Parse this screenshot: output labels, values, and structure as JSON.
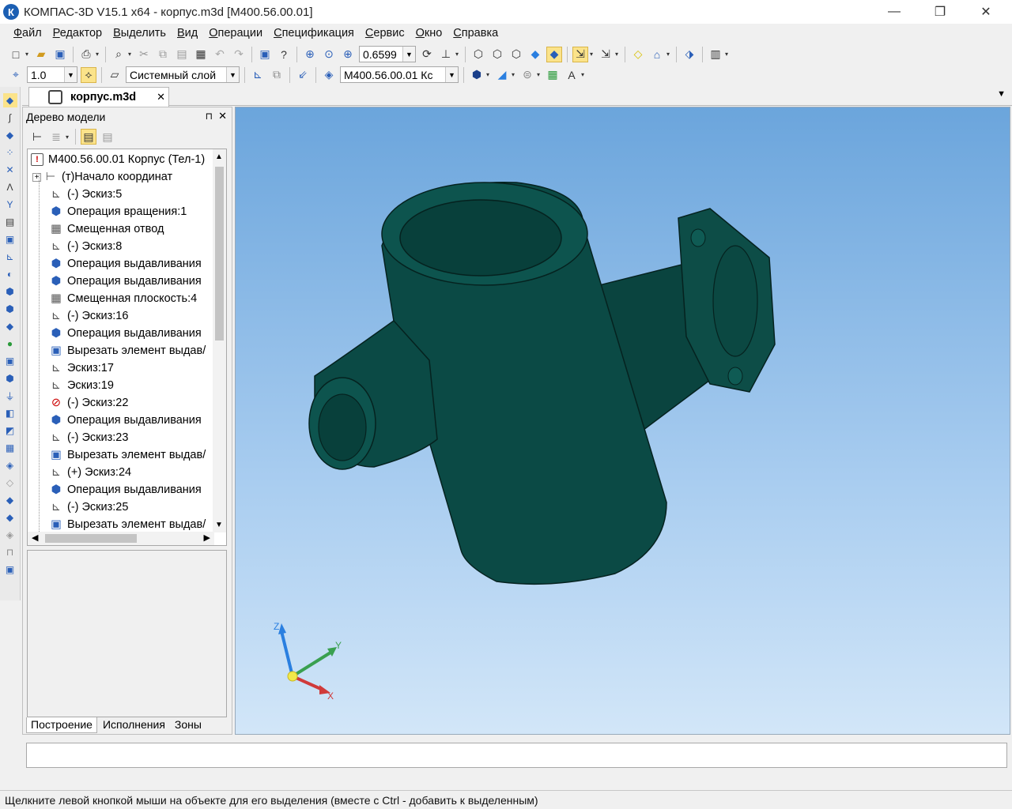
{
  "window": {
    "app_icon": "К",
    "title": "КОМПАС-3D V15.1 x64 - корпус.m3d [M400.56.00.01]",
    "minimize": "—",
    "maximize": "❐",
    "close": "✕"
  },
  "menu": [
    "Файл",
    "Редактор",
    "Выделить",
    "Вид",
    "Операции",
    "Спецификация",
    "Сервис",
    "Окно",
    "Справка"
  ],
  "toolbar1": {
    "zoom_value": "0.6599"
  },
  "toolbar2": {
    "step_value": "1.0",
    "layer": "Системный слой",
    "designation": "М400.56.00.01 Кс"
  },
  "document_tab": {
    "label": "корпус.m3d",
    "close": "✕"
  },
  "tabs_menu_arrow": "▼",
  "tree_panel": {
    "title": "Дерево модели",
    "pin": "⊓",
    "close": "✕",
    "root": "М400.56.00.01 Корпус (Тел-1)",
    "items": [
      "(т)Начало координат",
      "(-) Эскиз:5",
      "Операция вращения:1",
      "Смещенная отвод",
      "(-) Эскиз:8",
      "Операция выдавливания",
      "Операция выдавливания",
      "Смещенная плоскость:4",
      "(-) Эскиз:16",
      "Операция выдавливания",
      "Вырезать элемент выдав/",
      "Эскиз:17",
      "Эскиз:19",
      "(-) Эскиз:22",
      "Операция выдавливания",
      "(-) Эскиз:23",
      "Вырезать элемент выдав/",
      "(+) Эскиз:24",
      "Операция выдавливания",
      "(-) Эскиз:25",
      "Вырезать элемент выдав/"
    ],
    "bottom_tabs": [
      "Построение",
      "Исполнения",
      "Зоны"
    ]
  },
  "axes": {
    "x": "X",
    "y": "Y",
    "z": "Z"
  },
  "status": "Щелкните левой кнопкой мыши на объекте для его выделения (вместе с Ctrl - добавить к выделенным)",
  "colors": {
    "model": "#0b4a45",
    "viewport_top": "#6ba5dc",
    "viewport_bottom": "#d2e6f8"
  }
}
